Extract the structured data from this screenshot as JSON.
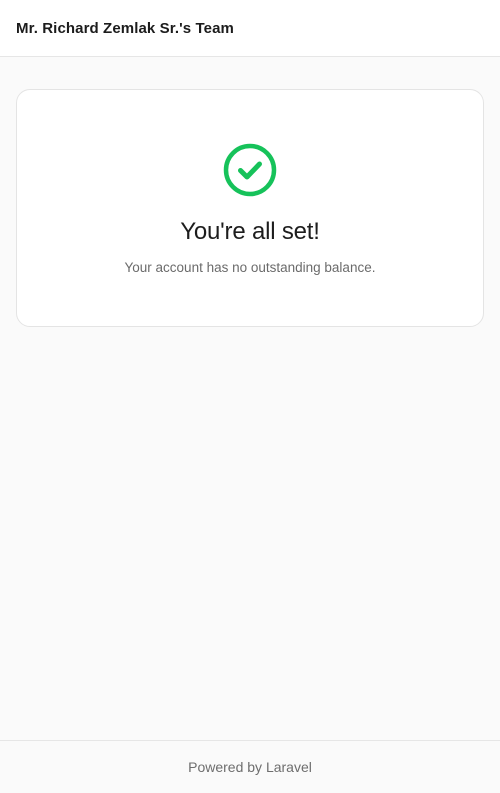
{
  "header": {
    "team_name": "Mr. Richard Zemlak Sr.'s Team"
  },
  "status_card": {
    "icon": "check-circle-icon",
    "icon_color": "#16c25a",
    "title": "You're all set!",
    "message": "Your account has no outstanding balance."
  },
  "footer": {
    "powered_by": "Powered by Laravel"
  }
}
